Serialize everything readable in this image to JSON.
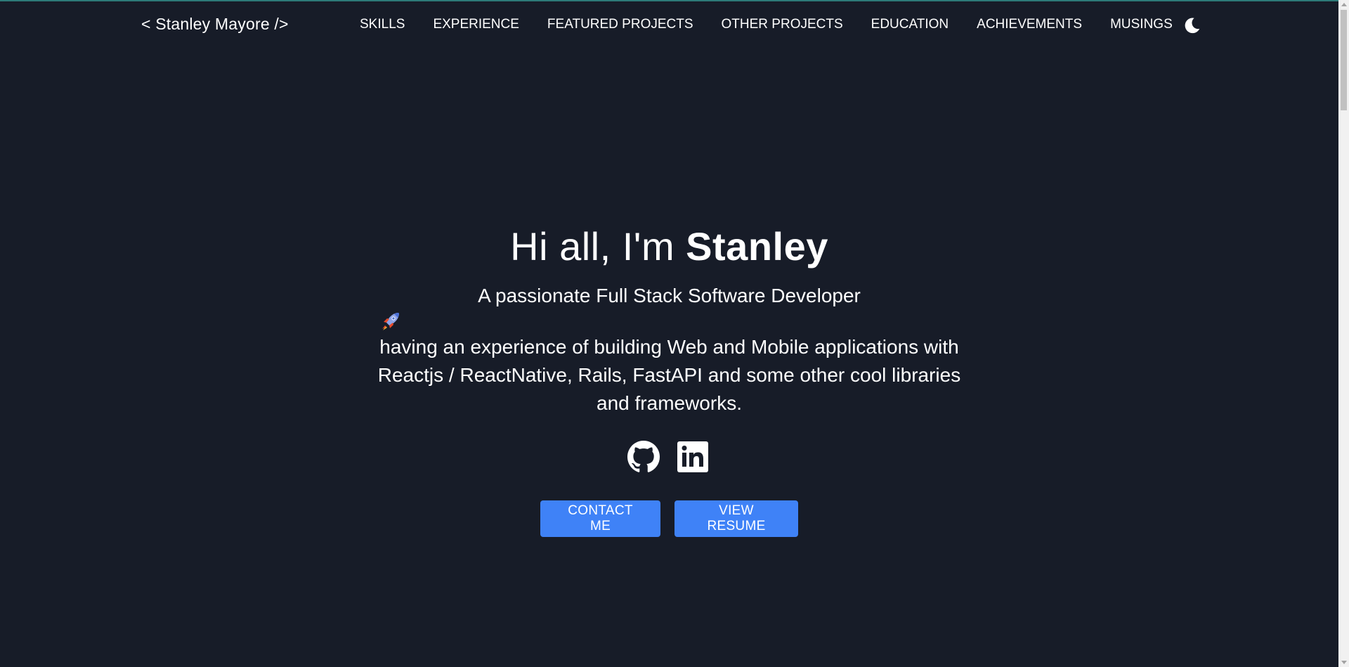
{
  "navbar": {
    "logo": "< Stanley Mayore />",
    "links": [
      "SKILLS",
      "EXPERIENCE",
      "FEATURED PROJECTS",
      "OTHER PROJECTS",
      "EDUCATION",
      "ACHIEVEMENTS",
      "MUSINGS"
    ],
    "theme_icon": "moon-icon"
  },
  "hero": {
    "greeting_prefix": "Hi all, I'm ",
    "greeting_name": "Stanley",
    "subtitle": "A passionate Full Stack Software Developer",
    "rocket_icon": "rocket-emoji",
    "description": "having an experience of building Web and Mobile applications with Reactjs / ReactNative, Rails, FastAPI and some other cool libraries and frameworks.",
    "social_icons": [
      "github-icon",
      "linkedin-icon"
    ],
    "buttons": {
      "contact": "CONTACT ME",
      "resume": "VIEW RESUME"
    }
  },
  "colors": {
    "background": "#171c28",
    "button": "#3f82f7",
    "text": "#ffffff",
    "top_border": "#2d7a78"
  }
}
